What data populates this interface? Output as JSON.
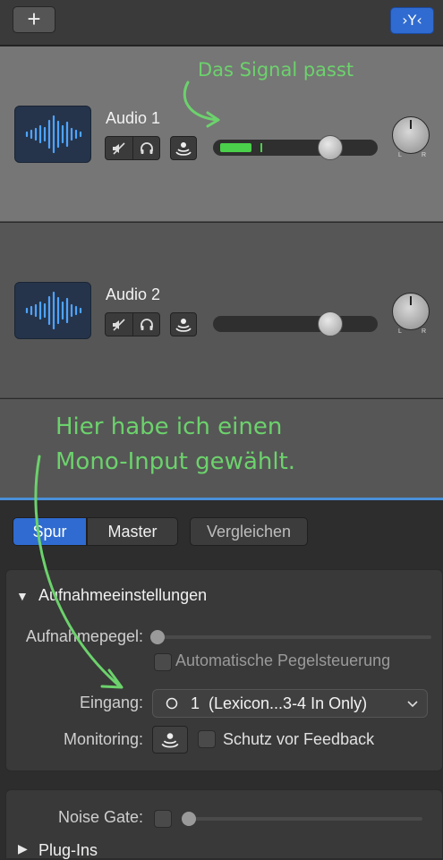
{
  "toolbar": {
    "add_glyph": "+",
    "filter_glyph": "›Y‹"
  },
  "tracks": [
    {
      "name": "Audio 1",
      "volume": 0.72,
      "input_level": 0.25,
      "pan_left": "L",
      "pan_right": "R"
    },
    {
      "name": "Audio 2",
      "volume": 0.72,
      "input_level": 0.0,
      "pan_left": "L",
      "pan_right": "R"
    }
  ],
  "annotations": {
    "signal": "Das Signal passt",
    "mono_line1": "Hier habe ich einen",
    "mono_line2": "Mono-Input gewählt."
  },
  "inspector": {
    "tabs": [
      "Spur",
      "Master"
    ],
    "compare": "Vergleichen",
    "recording_settings": {
      "title": "Aufnahmeeinstellungen",
      "level_label": "Aufnahmepegel:",
      "auto_level_label": "Automatische Pegelsteuerung",
      "input_label": "Eingang:",
      "input_value": "1  (Lexicon...3-4 In Only)",
      "monitoring_label": "Monitoring:",
      "feedback_label": "Schutz vor Feedback"
    },
    "noise_gate_label": "Noise Gate:",
    "plugins_label": "Plug-Ins"
  },
  "colors": {
    "accent": "#2f6bd0",
    "annotation": "#6cd26c",
    "level": "#4ad04a"
  }
}
